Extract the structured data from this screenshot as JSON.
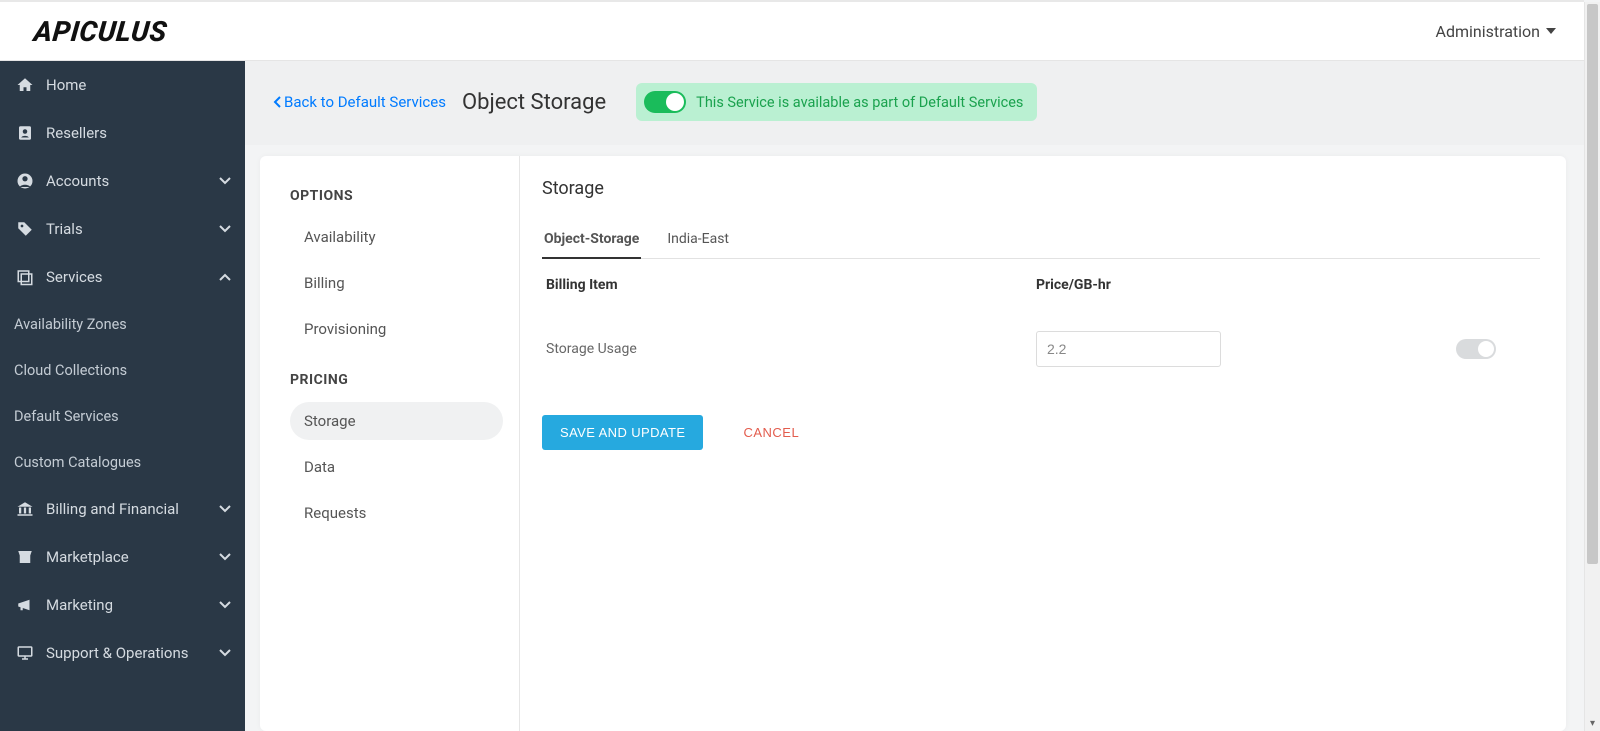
{
  "header": {
    "logo_text": "APICULUS",
    "admin_label": "Administration"
  },
  "sidebar": {
    "items": [
      {
        "label": "Home"
      },
      {
        "label": "Resellers"
      },
      {
        "label": "Accounts"
      },
      {
        "label": "Trials"
      },
      {
        "label": "Services"
      },
      {
        "label": "Billing and Financial"
      },
      {
        "label": "Marketplace"
      },
      {
        "label": "Marketing"
      },
      {
        "label": "Support & Operations"
      }
    ],
    "services_sub": [
      {
        "label": "Availability Zones"
      },
      {
        "label": "Cloud Collections"
      },
      {
        "label": "Default Services"
      },
      {
        "label": "Custom Catalogues"
      }
    ]
  },
  "page": {
    "back_label": "Back to Default Services",
    "title": "Object Storage",
    "status_text": "This Service is available as part of Default Services"
  },
  "options": {
    "head1": "OPTIONS",
    "group1": [
      {
        "label": "Availability"
      },
      {
        "label": "Billing"
      },
      {
        "label": "Provisioning"
      }
    ],
    "head2": "PRICING",
    "group2": [
      {
        "label": "Storage"
      },
      {
        "label": "Data"
      },
      {
        "label": "Requests"
      }
    ],
    "active": "Storage"
  },
  "content": {
    "title": "Storage",
    "tabs": [
      {
        "label": "Object-Storage",
        "active": true
      },
      {
        "label": "India-East",
        "active": false
      }
    ],
    "table": {
      "head_billing": "Billing Item",
      "head_price": "Price/GB-hr",
      "rows": [
        {
          "billing_item": "Storage Usage",
          "price": "2.2",
          "enabled": false
        }
      ]
    },
    "save_label": "SAVE AND UPDATE",
    "cancel_label": "CANCEL"
  }
}
